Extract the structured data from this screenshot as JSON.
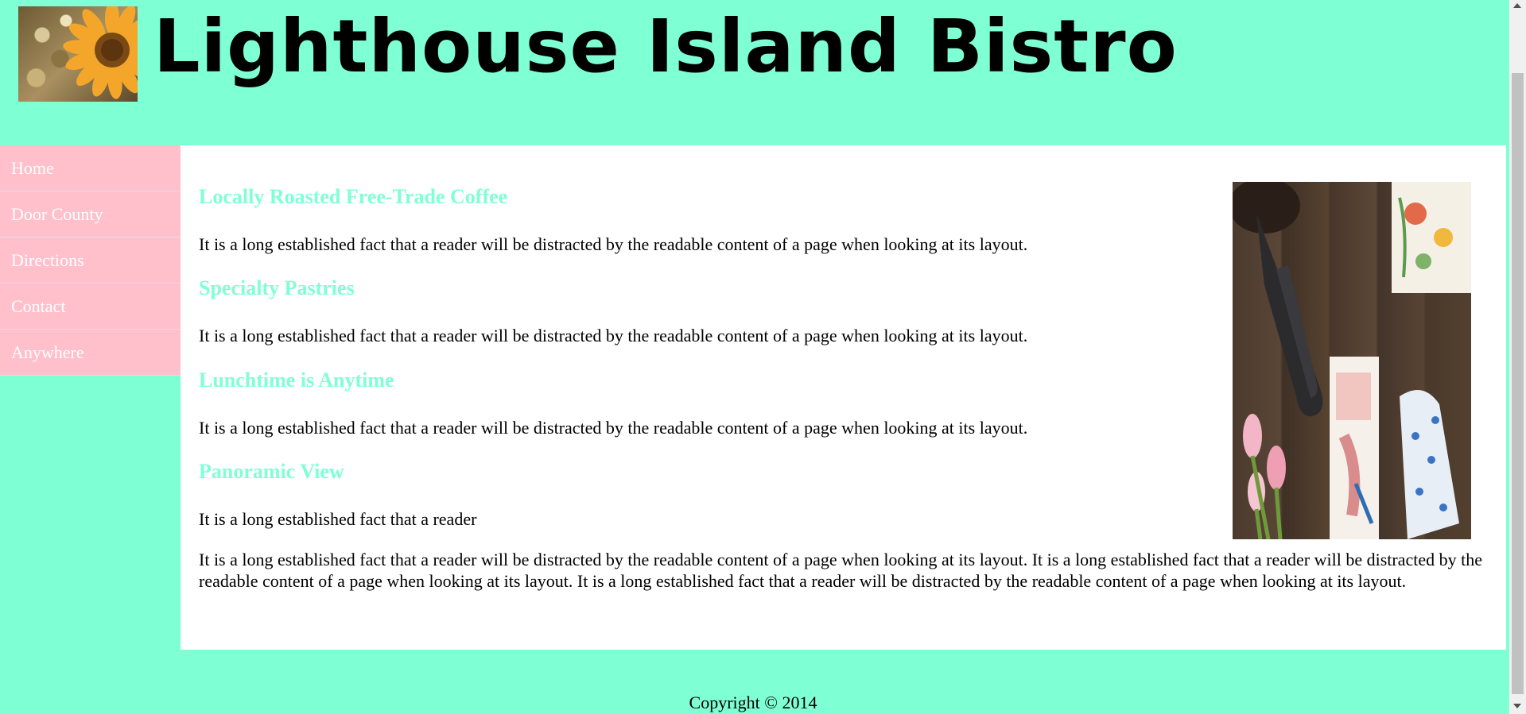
{
  "header": {
    "title": "Lighthouse Island Bistro",
    "logo_icon": "sunflower-photo"
  },
  "nav": {
    "items": [
      {
        "label": "Home"
      },
      {
        "label": "Door County"
      },
      {
        "label": "Directions"
      },
      {
        "label": "Contact"
      },
      {
        "label": "Anywhere"
      }
    ]
  },
  "main": {
    "sections": [
      {
        "heading": "Locally Roasted Free-Trade Coffee",
        "text": "It is a long established fact that a reader will be distracted by the readable content of a page when looking at its layout."
      },
      {
        "heading": "Specialty Pastries",
        "text": "It is a long established fact that a reader will be distracted by the readable content of a page when looking at its layout."
      },
      {
        "heading": "Lunchtime is Anytime",
        "text": "It is a long established fact that a reader will be distracted by the readable content of a page when looking at its layout."
      },
      {
        "heading": "Panoramic View",
        "text": "It is a long established fact that a reader"
      }
    ],
    "long_paragraph": "It is a long established fact that a reader will be distracted by the readable content of a page when looking at its layout. It is a long established fact that a reader will be distracted by the readable content of a page when looking at its layout. It is a long established fact that a reader will be distracted by the readable content of a page when looking at its layout.",
    "image_icon": "garden-tools-photo"
  },
  "footer": {
    "copyright": "Copyright © 2014"
  },
  "colors": {
    "background": "#7fffd4",
    "nav_background": "#ffc0cb",
    "heading": "#7fffd4",
    "content_background": "#ffffff"
  }
}
